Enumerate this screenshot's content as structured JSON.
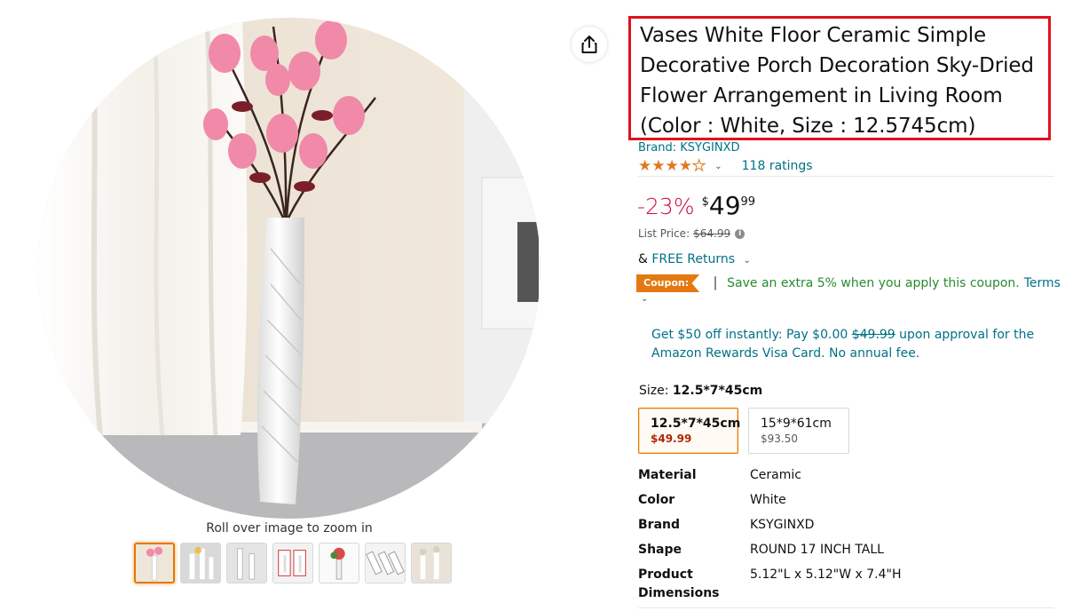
{
  "product": {
    "title": "Vases White Floor Ceramic Simple Decorative Porch Decoration Sky-Dried Flower Arrangement in Living Room (Color : White, Size : 12.5745cm)",
    "brand_link": "Brand: KSYGINXD",
    "rating": 4.0,
    "ratings_count": "118 ratings",
    "discount": "-23%",
    "price_symbol": "$",
    "price_whole": "49",
    "price_fraction": "99",
    "list_price_label": "List Price:",
    "list_price_value": "$64.99",
    "returns_prefix": "&",
    "returns_link": "FREE Returns",
    "coupon_badge": "Coupon:",
    "coupon_text": "Save an extra 5% when you apply this coupon.",
    "coupon_terms": "Terms",
    "rewards_text_1": "Get $50 off instantly: Pay $0.00",
    "rewards_strike": "$49.99",
    "rewards_text_2": "upon approval for the Amazon Rewards Visa Card. No annual fee."
  },
  "size": {
    "label": "Size:",
    "selected": "12.5*7*45cm",
    "options": [
      {
        "name": "12.5*7*45cm",
        "price": "$49.99"
      },
      {
        "name": "15*9*61cm",
        "price": "$93.50"
      }
    ]
  },
  "specs": [
    {
      "key": "Material",
      "value": "Ceramic"
    },
    {
      "key": "Color",
      "value": "White"
    },
    {
      "key": "Brand",
      "value": "KSYGINXD"
    },
    {
      "key": "Shape",
      "value": "ROUND 17 INCH TALL"
    },
    {
      "key": "Product Dimensions",
      "value": "5.12\"L x 5.12\"W x 7.4\"H"
    }
  ],
  "gallery": {
    "zoom_hint": "Roll over image to zoom in",
    "thumbnail_count": 7
  },
  "icons": {
    "share": "share-icon",
    "star": "star-icon",
    "info": "info-icon",
    "chevron": "chevron-down-icon"
  },
  "colors": {
    "link": "#007185",
    "discount": "#cc0c39",
    "coupon": "#e47911",
    "coupon_text": "#2b8a2f",
    "highlight_box": "#e0121b",
    "star": "#de7921"
  }
}
